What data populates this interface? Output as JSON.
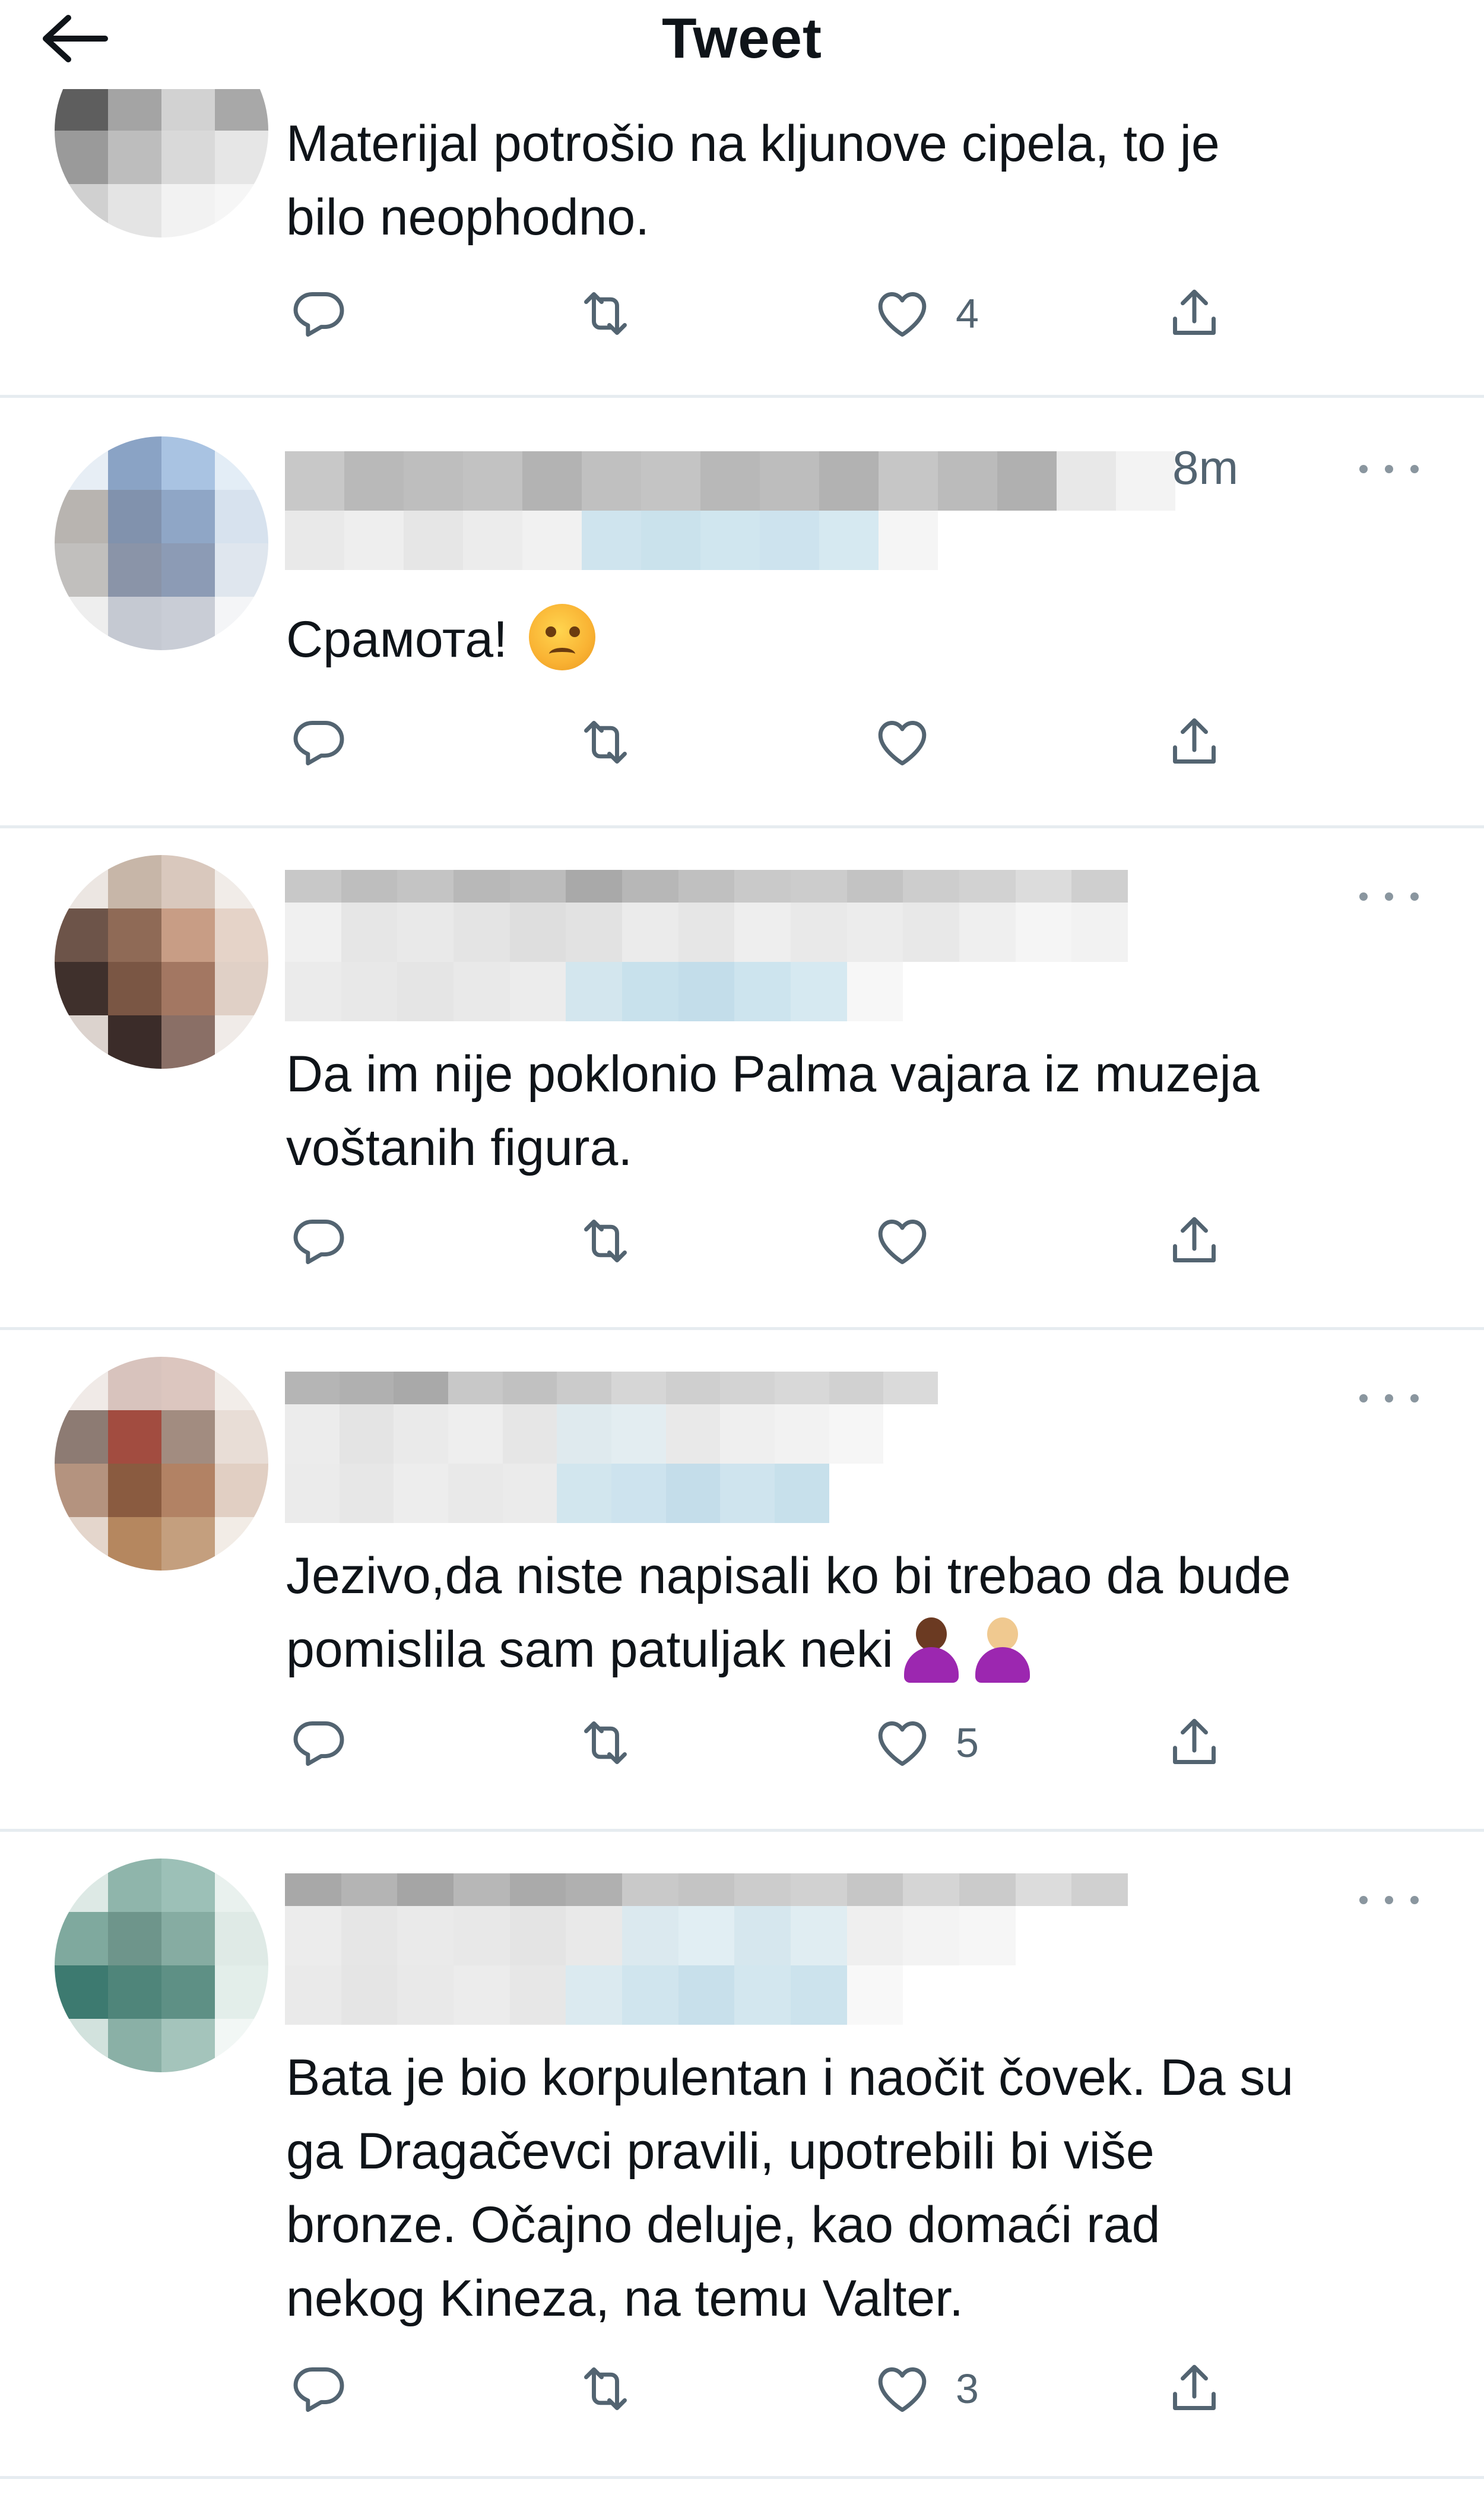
{
  "header": {
    "title": "Tweet",
    "back_icon": "arrow-left-icon"
  },
  "colors": {
    "text": "#0f1419",
    "secondary": "#536471",
    "divider": "#e6ecf0"
  },
  "tweets": [
    {
      "text": "Materijal potrošio na kljunove cipela, to je\nbilo neophodno.",
      "timestamp": "",
      "reply_count": "",
      "retweet_count": "",
      "like_count": "4"
    },
    {
      "text": "Срамота! ",
      "emoji": "angry-face-emoji",
      "timestamp": "8m",
      "reply_count": "",
      "retweet_count": "",
      "like_count": ""
    },
    {
      "text": "Da im nije poklonio Palma vajara iz muzeja\nvoštanih figura.",
      "timestamp": "",
      "reply_count": "",
      "retweet_count": "",
      "like_count": ""
    },
    {
      "text": "Jezivo,da niste napisali ko bi trebao da bude\npomislila sam patuljak neki",
      "emoji": "person-shrugging-emoji",
      "timestamp": "",
      "reply_count": "",
      "retweet_count": "",
      "like_count": "5"
    },
    {
      "text": "Bata je bio korpulentan i naočit čovek. Da su\nga Dragačevci pravili, upotrebili bi više\nbronze. Očajno deluje, kao domaći rad\nnekog Kineza, na temu Valter.",
      "timestamp": "",
      "reply_count": "",
      "retweet_count": "",
      "like_count": "3"
    }
  ]
}
